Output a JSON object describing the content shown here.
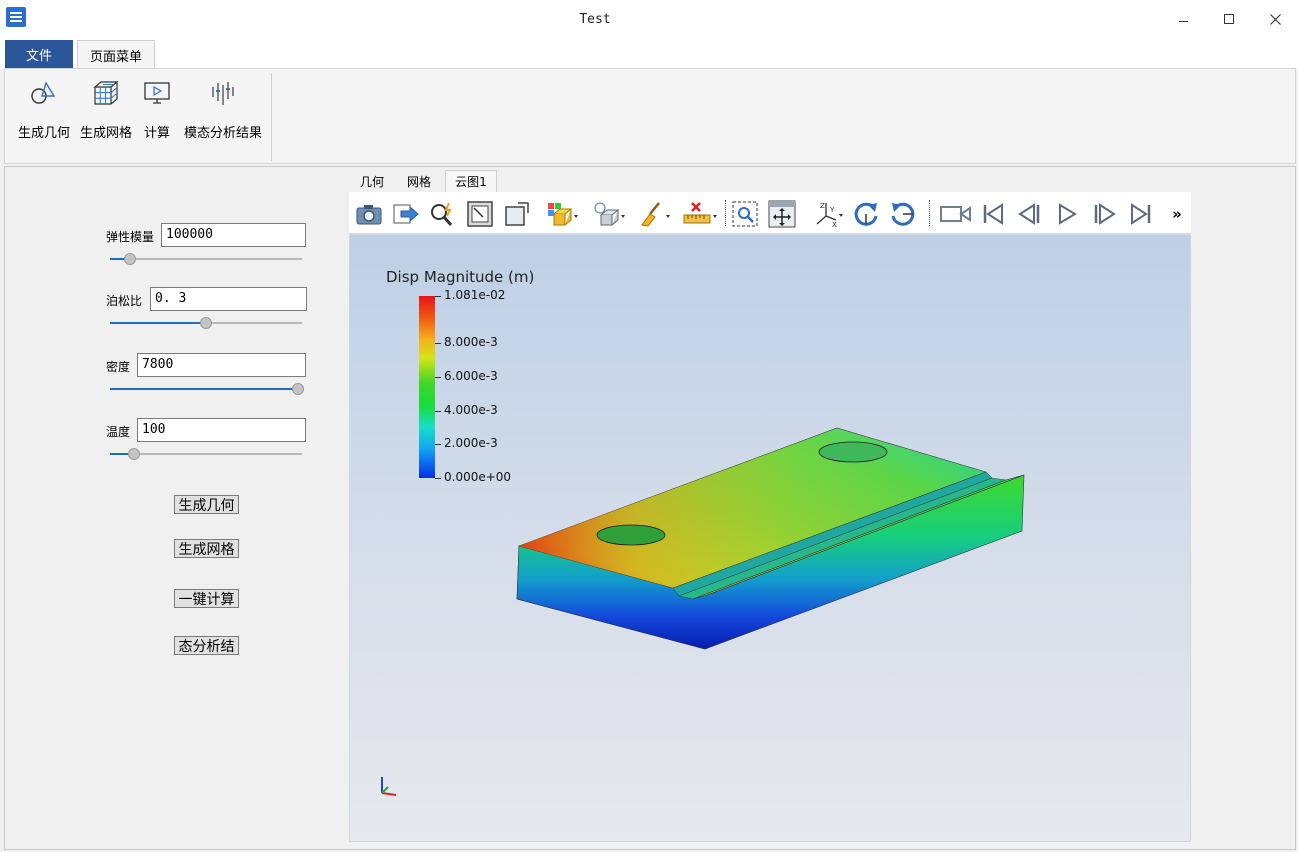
{
  "window": {
    "title": "Test"
  },
  "ribbon": {
    "tabs": [
      {
        "label": "文件"
      },
      {
        "label": "页面菜单"
      }
    ],
    "buttons": [
      {
        "label": "生成几何",
        "icon": "geometry-icon"
      },
      {
        "label": "生成网格",
        "icon": "mesh-icon"
      },
      {
        "label": "计算",
        "icon": "compute-icon"
      },
      {
        "label": "模态分析结果",
        "icon": "modal-results-icon"
      }
    ]
  },
  "params": [
    {
      "label": "弹性模量",
      "value": "100000",
      "slider_fraction": 0.08
    },
    {
      "label": "泊松比",
      "value": "0. 3",
      "slider_fraction": 0.5
    },
    {
      "label": "密度",
      "value": "7800",
      "slider_fraction": 1.0
    },
    {
      "label": "温度",
      "value": "100",
      "slider_fraction": 0.1
    }
  ],
  "actions": [
    {
      "label": "生成几何"
    },
    {
      "label": "生成网格"
    },
    {
      "label": "一键计算"
    },
    {
      "label": "态分析结"
    }
  ],
  "view_tabs": [
    {
      "label": "几何"
    },
    {
      "label": "网格"
    },
    {
      "label": "云图1"
    }
  ],
  "view_tabs_active": 2,
  "toolbar": {
    "icons": [
      "camera-icon",
      "export-icon",
      "zoom-pick-icon",
      "fit-view-icon",
      "box-view-icon",
      "render-mode-icon",
      "lighting-icon",
      "clear-brush-icon",
      "measure-ruler-icon",
      "zoom-box-icon",
      "pan-icon",
      "axes-orient-icon",
      "rotate-cw-icon",
      "rotate-ccw-icon",
      "record-camera-icon",
      "first-frame-icon",
      "prev-frame-icon",
      "play-icon",
      "next-frame-icon",
      "last-frame-icon"
    ],
    "overflow": "»"
  },
  "legend": {
    "title": "Disp Magnitude (m)",
    "labels": [
      {
        "text": "1.081e-02",
        "value": 0.01081
      },
      {
        "text": "8.000e-3",
        "value": 0.008
      },
      {
        "text": "6.000e-3",
        "value": 0.006
      },
      {
        "text": "4.000e-3",
        "value": 0.004
      },
      {
        "text": "2.000e-3",
        "value": 0.002
      },
      {
        "text": "0.000e+00",
        "value": 0.0
      }
    ],
    "max": 0.01081,
    "min": 0.0
  }
}
